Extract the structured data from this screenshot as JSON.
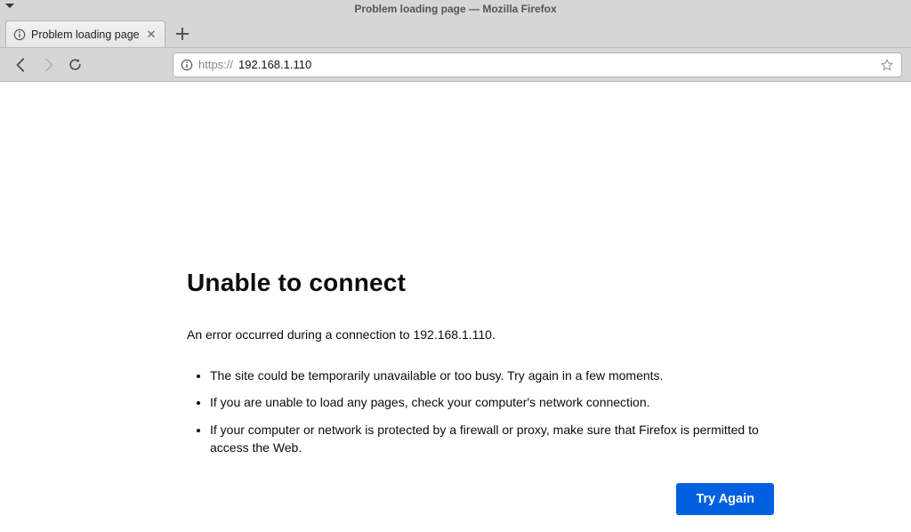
{
  "window": {
    "title": "Problem loading page — Mozilla Firefox"
  },
  "tab": {
    "title": "Problem loading page"
  },
  "address": {
    "protocol": "https://",
    "host": "192.168.1.110"
  },
  "error": {
    "heading": "Unable to connect",
    "message": "An error occurred during a connection to 192.168.1.110.",
    "bullets": [
      "The site could be temporarily unavailable or too busy. Try again in a few moments.",
      "If you are unable to load any pages, check your computer's network connection.",
      "If your computer or network is protected by a firewall or proxy, make sure that Firefox is permitted to access the Web."
    ],
    "try_again": "Try Again"
  }
}
